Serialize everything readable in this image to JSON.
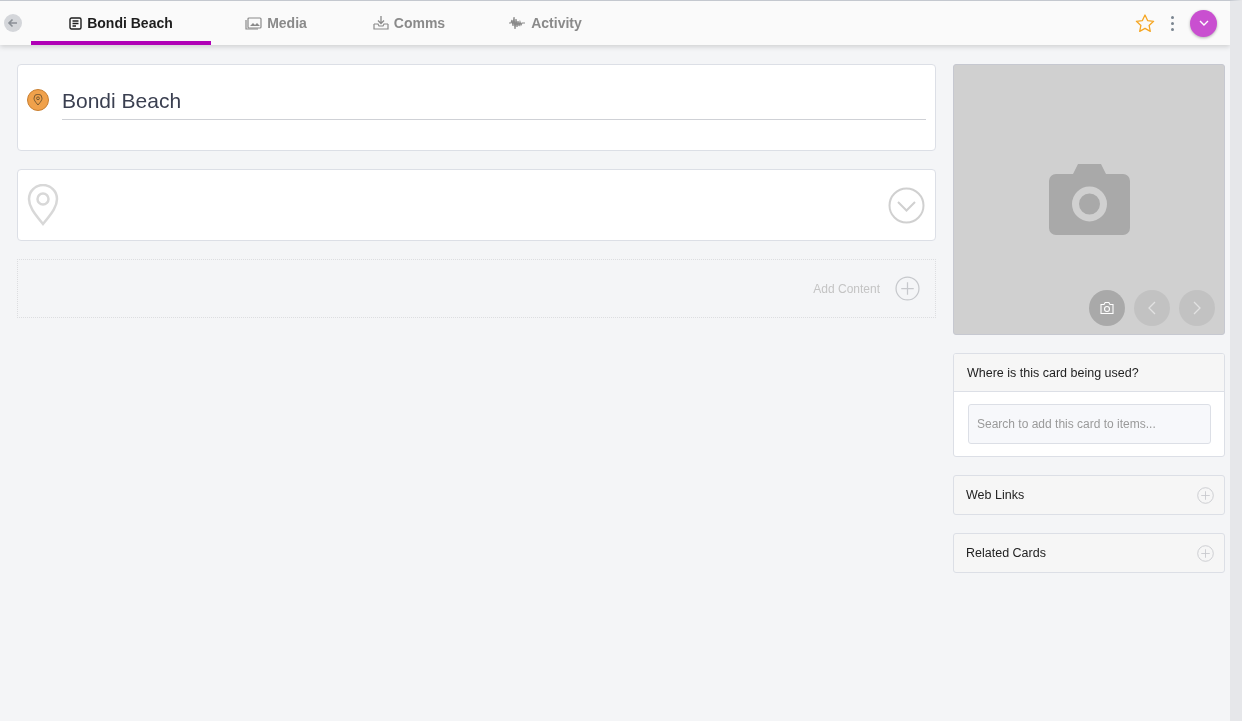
{
  "tabs": [
    {
      "label": "Bondi Beach",
      "kind": "document",
      "selected": true
    },
    {
      "label": "Media",
      "kind": "images",
      "selected": false
    },
    {
      "label": "Comms",
      "kind": "inbox",
      "selected": false
    },
    {
      "label": "Activity",
      "kind": "wave",
      "selected": false
    }
  ],
  "title": {
    "value": "Bondi Beach"
  },
  "add_content": {
    "label": "Add Content"
  },
  "usage": {
    "heading": "Where is this card being used?",
    "placeholder": "Search to add this card to items..."
  },
  "sections": [
    {
      "label": "Web Links"
    },
    {
      "label": "Related Cards"
    }
  ]
}
